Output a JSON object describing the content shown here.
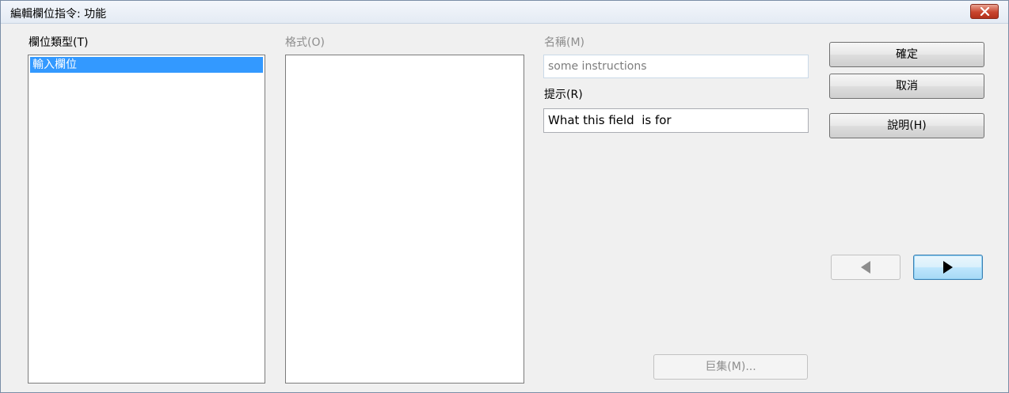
{
  "window": {
    "title": "編輯欄位指令: 功能",
    "close_icon": "close-icon"
  },
  "field_type": {
    "label": "欄位類型(T)",
    "items": [
      "輸入欄位"
    ],
    "selected_index": 0
  },
  "format": {
    "label": "格式(O)",
    "items": []
  },
  "name": {
    "label": "名稱(M)",
    "value": "some instructions",
    "disabled": true
  },
  "prompt": {
    "label": "提示(R)",
    "value": "What this field  is for"
  },
  "buttons": {
    "ok_label": "確定",
    "cancel_label": "取消",
    "help_label": "說明(H)",
    "macro_label": "巨集(M)...",
    "prev_icon": "left-triangle-icon",
    "next_icon": "right-triangle-icon"
  },
  "colors": {
    "selection": "#3399ff",
    "close_button": "#c9452e",
    "focus_border": "#3c7fb1"
  }
}
